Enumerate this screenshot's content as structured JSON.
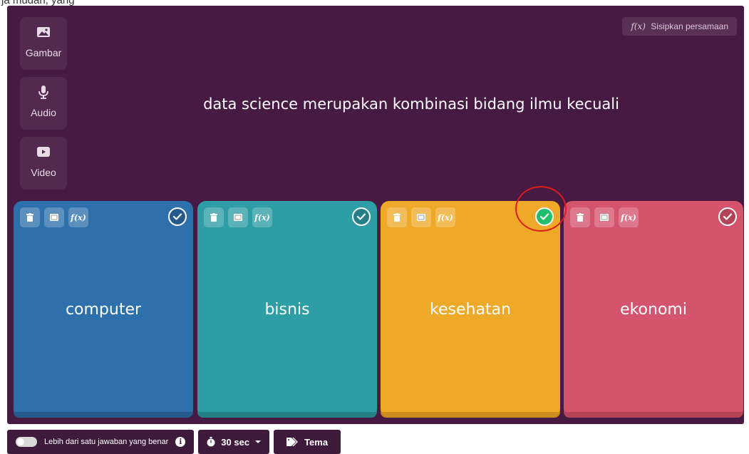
{
  "top_text": "ja mudah, yang",
  "media_buttons": [
    {
      "label": "Gambar",
      "icon": "image-icon"
    },
    {
      "label": "Audio",
      "icon": "microphone-icon"
    },
    {
      "label": "Video",
      "icon": "video-play-icon"
    }
  ],
  "equation_button": {
    "fx": "f(x)",
    "label": "Sisipkan persamaan"
  },
  "question": "data science merupakan kombinasi bidang ilmu kecuali",
  "options": [
    {
      "text": "computer",
      "color": "#2d70ac",
      "shade": "#245a8c",
      "correct": false
    },
    {
      "text": "bisnis",
      "color": "#2d9da6",
      "shade": "#247f87",
      "correct": false
    },
    {
      "text": "kesehatan",
      "color": "#efa929",
      "shade": "#cc8c1c",
      "correct": true
    },
    {
      "text": "ekonomi",
      "color": "#d5546d",
      "shade": "#b44358",
      "correct": false
    }
  ],
  "option_tools": {
    "fx": "f(x)"
  },
  "bottom_bar": {
    "multi_answer_label": "Lebih dari satu jawaban yang benar",
    "info": "i",
    "time_label": "30 sec",
    "theme_label": "Tema"
  },
  "colors": {
    "editor_bg": "#461a42",
    "correct_check": "#1fbf6b",
    "highlight": "#e01b1b"
  }
}
